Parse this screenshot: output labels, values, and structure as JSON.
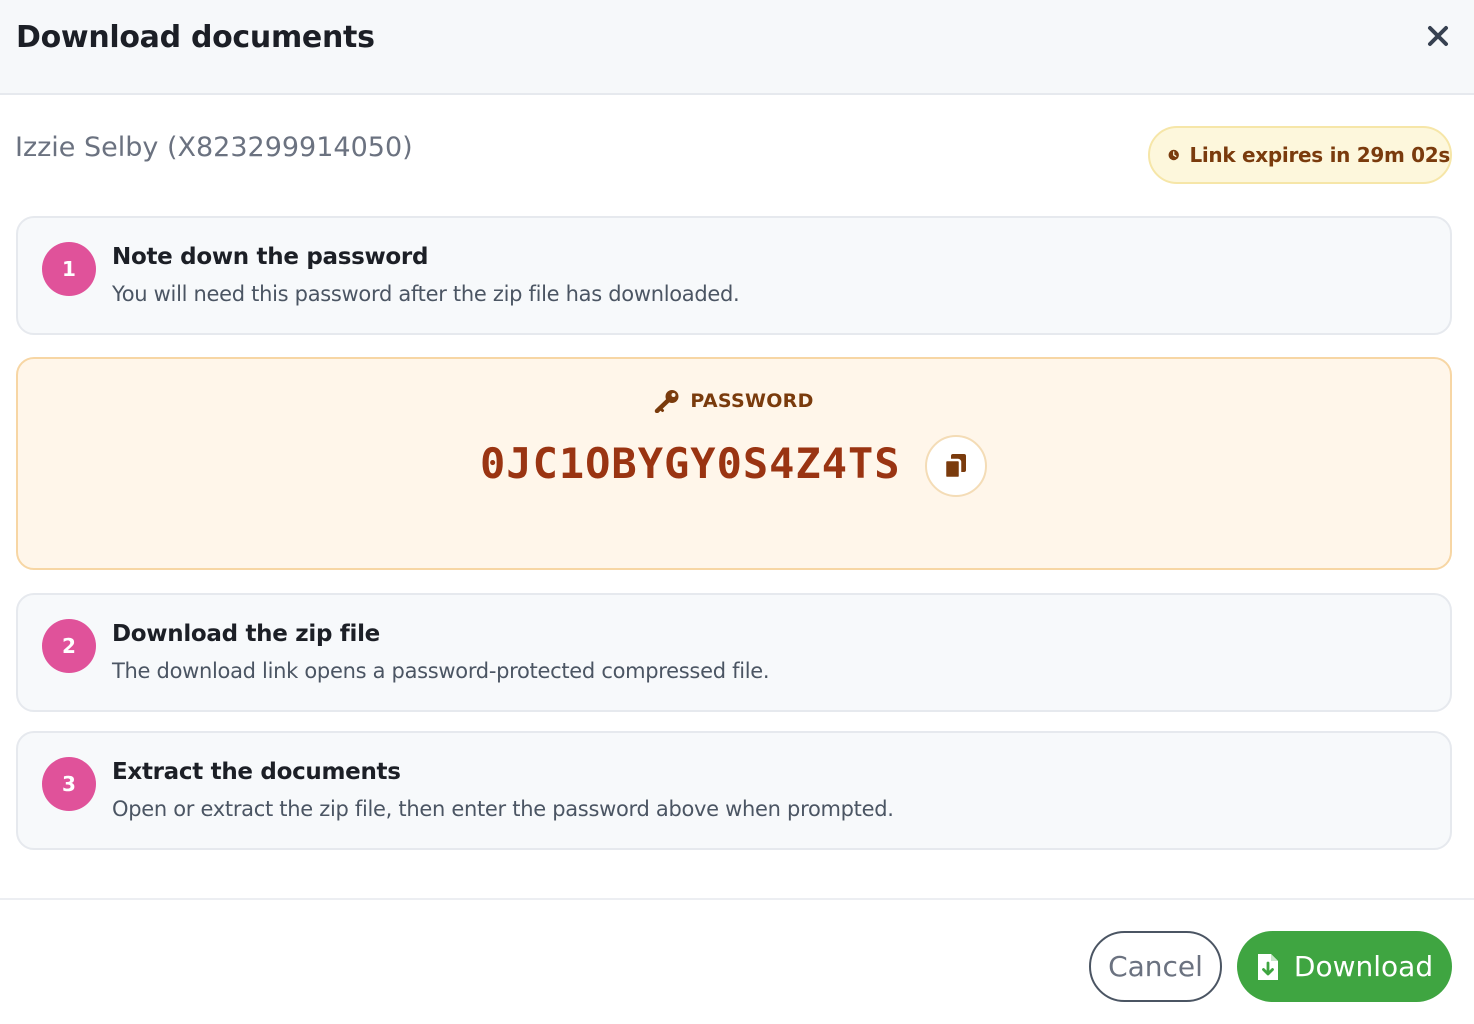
{
  "modal": {
    "title": "Download documents"
  },
  "client": {
    "name": "Izzie Selby (X823299914050)"
  },
  "expiry": {
    "text": "Link expires in 29m 02s"
  },
  "steps": [
    {
      "number": "1",
      "title": "Note down the password",
      "description": "You will need this password after the zip file has downloaded."
    },
    {
      "number": "2",
      "title": "Download the zip file",
      "description": "The download link opens a password-protected compressed file."
    },
    {
      "number": "3",
      "title": "Extract the documents",
      "description": "Open or extract the zip file, then enter the password above when prompted."
    }
  ],
  "password": {
    "label": "PASSWORD",
    "value": "0JC1OBYGY0S4Z4TS"
  },
  "footer": {
    "cancel_label": "Cancel",
    "download_label": "Download"
  },
  "icons": {
    "close": "close-icon",
    "clock": "clock-icon",
    "key": "key-icon",
    "copy": "copy-icon",
    "file_download": "file-download-icon"
  },
  "colors": {
    "step_badge": "#e0529a",
    "download_button": "#3fa541",
    "password_text": "#9a3412",
    "expiry_text": "#7a3b0d"
  }
}
